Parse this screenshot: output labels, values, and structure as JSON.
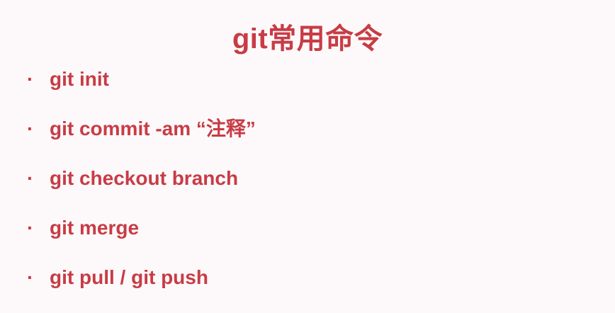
{
  "slide": {
    "title": "git常用命令",
    "bullet_symbol": "·",
    "items": [
      {
        "text": "git init"
      },
      {
        "text": "git commit -am “注释”"
      },
      {
        "text": "git checkout branch"
      },
      {
        "text": "git merge"
      },
      {
        "text": "git pull / git push"
      }
    ],
    "text_color": "#c83c45",
    "background_color": "#fdf9fb"
  }
}
